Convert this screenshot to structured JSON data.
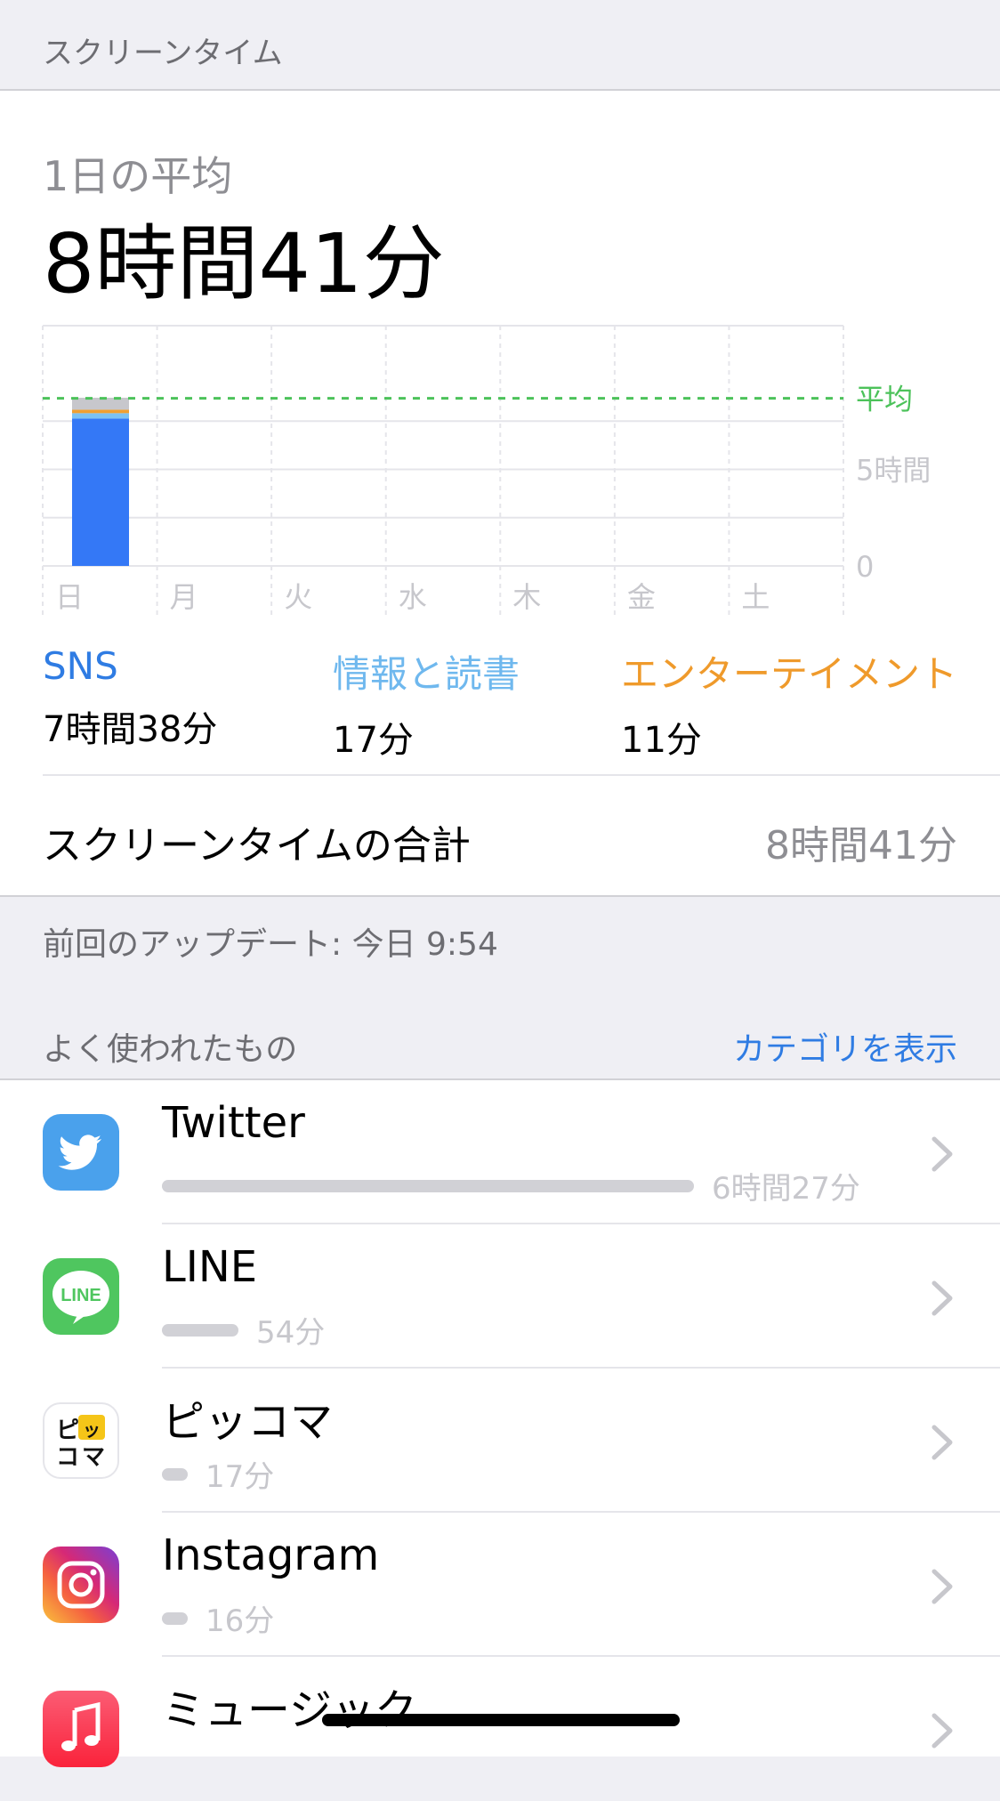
{
  "header": {
    "title": "スクリーンタイム"
  },
  "summary": {
    "avg_label": "1日の平均",
    "avg_value": "8時間41分"
  },
  "chart_data": {
    "type": "bar",
    "categories": [
      "日",
      "月",
      "火",
      "水",
      "木",
      "金",
      "土"
    ],
    "unit": "hours",
    "series": [
      {
        "name": "SNS",
        "values": [
          7.63,
          0,
          0,
          0,
          0,
          0,
          0
        ],
        "color": "#3478f6"
      },
      {
        "name": "情報と読書",
        "values": [
          0.28,
          0,
          0,
          0,
          0,
          0,
          0
        ],
        "color": "#7cc2f2"
      },
      {
        "name": "エンターテイメント",
        "values": [
          0.18,
          0,
          0,
          0,
          0,
          0,
          0
        ],
        "color": "#f0a030"
      },
      {
        "name": "その他",
        "values": [
          0.62,
          0,
          0,
          0,
          0,
          0,
          0
        ],
        "color": "#c7c7cc"
      }
    ],
    "average": 8.68,
    "average_label": "平均",
    "average_color": "#4cc25a",
    "y_tick_labels": [
      "0",
      "5時間"
    ],
    "ylim": [
      0,
      10
    ]
  },
  "categories": [
    {
      "name": "SNS",
      "time": "7時間38分",
      "color": "#2f7ce3"
    },
    {
      "name": "情報と読書",
      "time": "17分",
      "color": "#6fb8ee"
    },
    {
      "name": "エンターテイメント",
      "time": "11分",
      "color": "#ef9a2b"
    }
  ],
  "total": {
    "label": "スクリーンタイムの合計",
    "value": "8時間41分"
  },
  "updated": "前回のアップデート: 今日 9:54",
  "most_used": {
    "title": "よく使われたもの",
    "show_categories": "カテゴリを表示"
  },
  "apps": [
    {
      "name": "Twitter",
      "time": "6時間27分",
      "bar": 0.83,
      "icon": "twitter-icon"
    },
    {
      "name": "LINE",
      "time": "54分",
      "bar": 0.12,
      "icon": "line-icon",
      "icon_text": "LINE"
    },
    {
      "name": "ピッコマ",
      "time": "17分",
      "bar": 0.04,
      "icon": "piccoma-icon",
      "icon_text": "ピッコマ"
    },
    {
      "name": "Instagram",
      "time": "16分",
      "bar": 0.04,
      "icon": "instagram-icon"
    },
    {
      "name": "ミュージック",
      "time": "",
      "bar": 0,
      "icon": "music-icon"
    }
  ]
}
